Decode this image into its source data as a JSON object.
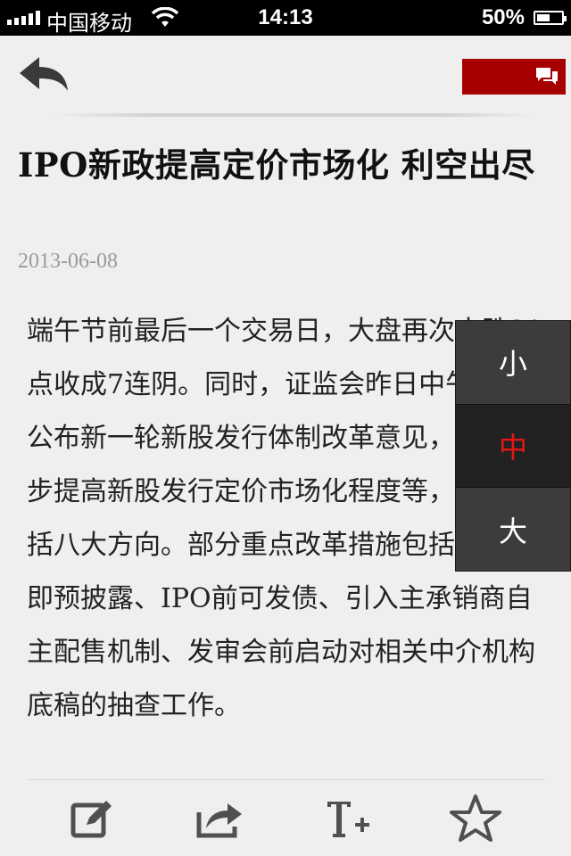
{
  "status_bar": {
    "carrier": "中国移动",
    "time": "14:13",
    "battery": "50%"
  },
  "header": {
    "back_icon": "back-arrow-icon",
    "comment_icon": "chat-bubbles-icon",
    "comment_color": "#a70000"
  },
  "article": {
    "title": "IPO新政提高定价市场化 利空出尽",
    "date": "2013-06-08",
    "body": "端午节前最后一个交易日，大盘再次大跌31点收成7连阴。同时，证监会昨日中午透露将公布新一轮新股发行体制改革意见，拟进一步提高新股发行定价市场化程度等，具体包括八大方向。部分重点改革措施包括：申报即预披露、IPO前可发债、引入主承销商自主配售机制、发审会前启动对相关中介机构底稿的抽查工作。"
  },
  "font_size_menu": {
    "options": [
      "小",
      "中",
      "大"
    ],
    "selected": "中",
    "selected_color": "#e61616"
  },
  "toolbar": {
    "items": [
      "edit-icon",
      "share-icon",
      "font-size-icon",
      "star-icon"
    ]
  }
}
